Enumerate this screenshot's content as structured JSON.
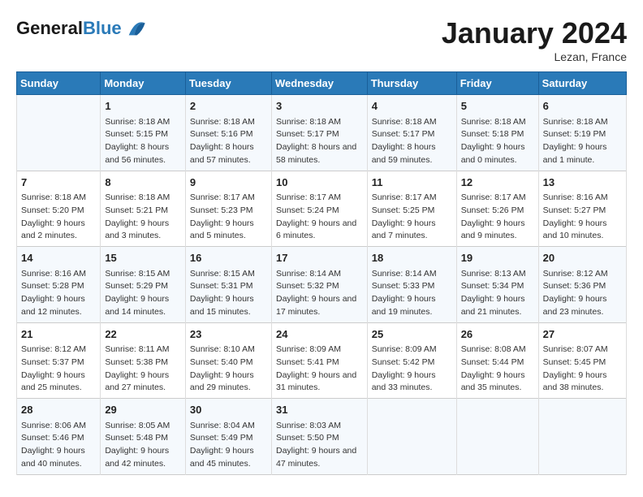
{
  "logo": {
    "line1": "General",
    "line2": "Blue"
  },
  "title": "January 2024",
  "location": "Lezan, France",
  "days_of_week": [
    "Sunday",
    "Monday",
    "Tuesday",
    "Wednesday",
    "Thursday",
    "Friday",
    "Saturday"
  ],
  "weeks": [
    [
      {
        "day": "",
        "info": ""
      },
      {
        "day": "1",
        "info": "Sunrise: 8:18 AM\nSunset: 5:15 PM\nDaylight: 8 hours and 56 minutes."
      },
      {
        "day": "2",
        "info": "Sunrise: 8:18 AM\nSunset: 5:16 PM\nDaylight: 8 hours and 57 minutes."
      },
      {
        "day": "3",
        "info": "Sunrise: 8:18 AM\nSunset: 5:17 PM\nDaylight: 8 hours and 58 minutes."
      },
      {
        "day": "4",
        "info": "Sunrise: 8:18 AM\nSunset: 5:17 PM\nDaylight: 8 hours and 59 minutes."
      },
      {
        "day": "5",
        "info": "Sunrise: 8:18 AM\nSunset: 5:18 PM\nDaylight: 9 hours and 0 minutes."
      },
      {
        "day": "6",
        "info": "Sunrise: 8:18 AM\nSunset: 5:19 PM\nDaylight: 9 hours and 1 minute."
      }
    ],
    [
      {
        "day": "7",
        "info": "Sunrise: 8:18 AM\nSunset: 5:20 PM\nDaylight: 9 hours and 2 minutes."
      },
      {
        "day": "8",
        "info": "Sunrise: 8:18 AM\nSunset: 5:21 PM\nDaylight: 9 hours and 3 minutes."
      },
      {
        "day": "9",
        "info": "Sunrise: 8:17 AM\nSunset: 5:23 PM\nDaylight: 9 hours and 5 minutes."
      },
      {
        "day": "10",
        "info": "Sunrise: 8:17 AM\nSunset: 5:24 PM\nDaylight: 9 hours and 6 minutes."
      },
      {
        "day": "11",
        "info": "Sunrise: 8:17 AM\nSunset: 5:25 PM\nDaylight: 9 hours and 7 minutes."
      },
      {
        "day": "12",
        "info": "Sunrise: 8:17 AM\nSunset: 5:26 PM\nDaylight: 9 hours and 9 minutes."
      },
      {
        "day": "13",
        "info": "Sunrise: 8:16 AM\nSunset: 5:27 PM\nDaylight: 9 hours and 10 minutes."
      }
    ],
    [
      {
        "day": "14",
        "info": "Sunrise: 8:16 AM\nSunset: 5:28 PM\nDaylight: 9 hours and 12 minutes."
      },
      {
        "day": "15",
        "info": "Sunrise: 8:15 AM\nSunset: 5:29 PM\nDaylight: 9 hours and 14 minutes."
      },
      {
        "day": "16",
        "info": "Sunrise: 8:15 AM\nSunset: 5:31 PM\nDaylight: 9 hours and 15 minutes."
      },
      {
        "day": "17",
        "info": "Sunrise: 8:14 AM\nSunset: 5:32 PM\nDaylight: 9 hours and 17 minutes."
      },
      {
        "day": "18",
        "info": "Sunrise: 8:14 AM\nSunset: 5:33 PM\nDaylight: 9 hours and 19 minutes."
      },
      {
        "day": "19",
        "info": "Sunrise: 8:13 AM\nSunset: 5:34 PM\nDaylight: 9 hours and 21 minutes."
      },
      {
        "day": "20",
        "info": "Sunrise: 8:12 AM\nSunset: 5:36 PM\nDaylight: 9 hours and 23 minutes."
      }
    ],
    [
      {
        "day": "21",
        "info": "Sunrise: 8:12 AM\nSunset: 5:37 PM\nDaylight: 9 hours and 25 minutes."
      },
      {
        "day": "22",
        "info": "Sunrise: 8:11 AM\nSunset: 5:38 PM\nDaylight: 9 hours and 27 minutes."
      },
      {
        "day": "23",
        "info": "Sunrise: 8:10 AM\nSunset: 5:40 PM\nDaylight: 9 hours and 29 minutes."
      },
      {
        "day": "24",
        "info": "Sunrise: 8:09 AM\nSunset: 5:41 PM\nDaylight: 9 hours and 31 minutes."
      },
      {
        "day": "25",
        "info": "Sunrise: 8:09 AM\nSunset: 5:42 PM\nDaylight: 9 hours and 33 minutes."
      },
      {
        "day": "26",
        "info": "Sunrise: 8:08 AM\nSunset: 5:44 PM\nDaylight: 9 hours and 35 minutes."
      },
      {
        "day": "27",
        "info": "Sunrise: 8:07 AM\nSunset: 5:45 PM\nDaylight: 9 hours and 38 minutes."
      }
    ],
    [
      {
        "day": "28",
        "info": "Sunrise: 8:06 AM\nSunset: 5:46 PM\nDaylight: 9 hours and 40 minutes."
      },
      {
        "day": "29",
        "info": "Sunrise: 8:05 AM\nSunset: 5:48 PM\nDaylight: 9 hours and 42 minutes."
      },
      {
        "day": "30",
        "info": "Sunrise: 8:04 AM\nSunset: 5:49 PM\nDaylight: 9 hours and 45 minutes."
      },
      {
        "day": "31",
        "info": "Sunrise: 8:03 AM\nSunset: 5:50 PM\nDaylight: 9 hours and 47 minutes."
      },
      {
        "day": "",
        "info": ""
      },
      {
        "day": "",
        "info": ""
      },
      {
        "day": "",
        "info": ""
      }
    ]
  ]
}
